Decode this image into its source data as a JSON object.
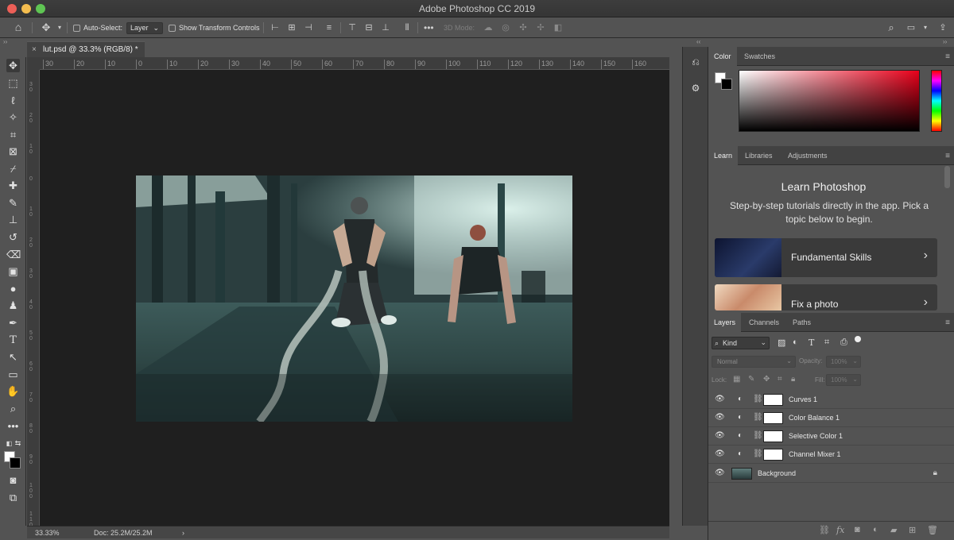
{
  "window": {
    "title": "Adobe Photoshop CC 2019"
  },
  "options_bar": {
    "auto_select_label": "Auto-Select:",
    "auto_select_value": "Layer",
    "show_transform_label": "Show Transform Controls",
    "mode_3d_label": "3D Mode:"
  },
  "document": {
    "tab_title": "lut.psd @ 33.3% (RGB/8) *",
    "ruler_top": [
      "30",
      "20",
      "10",
      "0",
      "10",
      "20",
      "30",
      "40",
      "50",
      "60",
      "70",
      "80",
      "90",
      "100",
      "110",
      "120",
      "130",
      "140",
      "150",
      "160"
    ],
    "ruler_left": [
      "3 0",
      "2 0",
      "1 0",
      "0",
      "1 0",
      "2 0",
      "3 0",
      "4 0",
      "5 0",
      "6 0",
      "7 0",
      "8 0",
      "9 0",
      "1 0 0",
      "1 1 0"
    ]
  },
  "status": {
    "zoom": "33.33%",
    "doc": "Doc: 25.2M/25.2M",
    "arrow": "›"
  },
  "color_panel": {
    "tabs": [
      "Color",
      "Swatches"
    ]
  },
  "learn_panel": {
    "tabs": [
      "Learn",
      "Libraries",
      "Adjustments"
    ],
    "title": "Learn Photoshop",
    "subtitle": "Step-by-step tutorials directly in the app. Pick a topic below to begin.",
    "cards": [
      {
        "label": "Fundamental Skills"
      },
      {
        "label": "Fix a photo"
      }
    ]
  },
  "layers_panel": {
    "tabs": [
      "Layers",
      "Channels",
      "Paths"
    ],
    "kind_label": "Kind",
    "blend_mode": "Normal",
    "opacity_label": "Opacity:",
    "opacity_value": "100%",
    "lock_label": "Lock:",
    "fill_label": "Fill:",
    "fill_value": "100%",
    "layers": [
      {
        "name": "Curves 1"
      },
      {
        "name": "Color Balance 1"
      },
      {
        "name": "Selective Color 1"
      },
      {
        "name": "Channel Mixer 1"
      },
      {
        "name": "Background"
      }
    ]
  }
}
